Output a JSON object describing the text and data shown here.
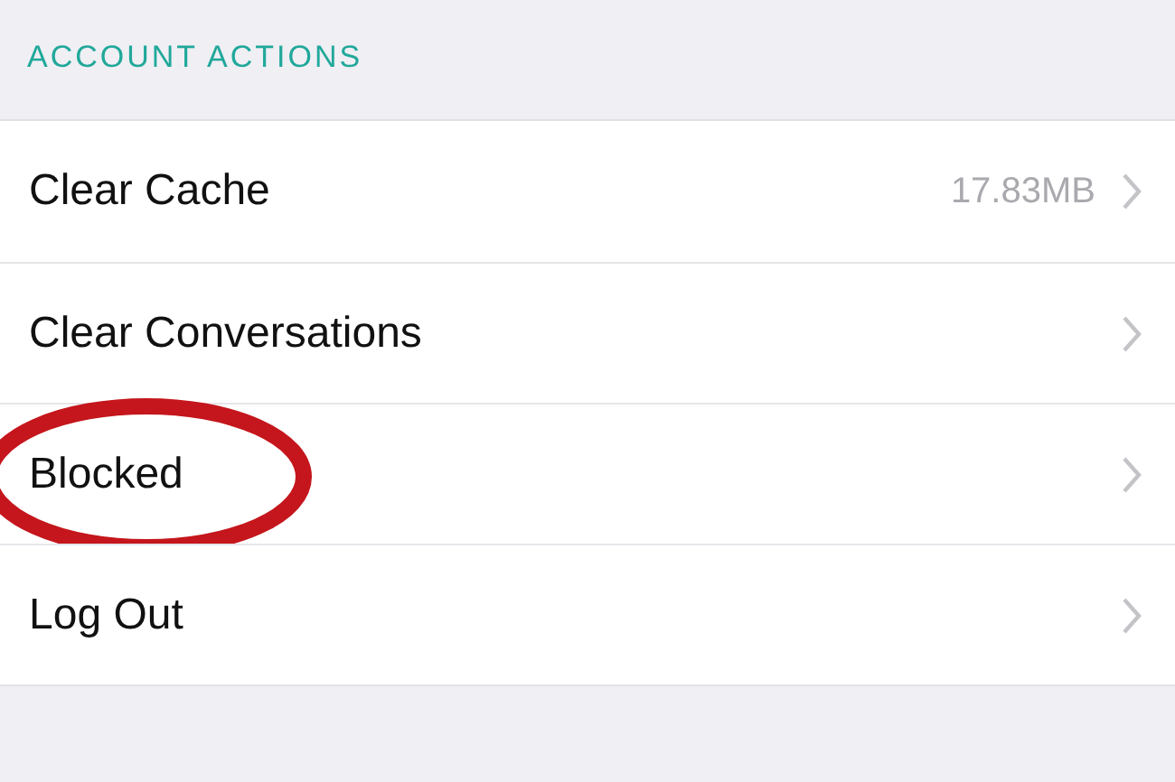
{
  "section": {
    "title": "ACCOUNT ACTIONS"
  },
  "rows": [
    {
      "label": "Clear Cache",
      "value": "17.83MB",
      "circled": false
    },
    {
      "label": "Clear Conversations",
      "circled": false
    },
    {
      "label": "Blocked",
      "circled": true
    },
    {
      "label": "Log Out",
      "circled": false
    }
  ]
}
